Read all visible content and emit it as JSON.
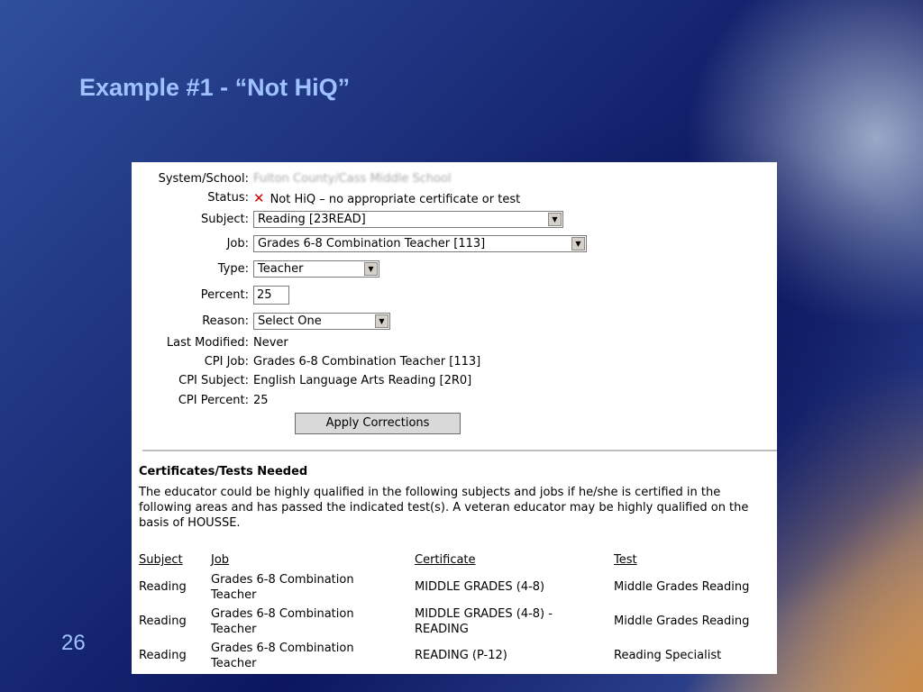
{
  "slide": {
    "title": "Example #1 - “Not HiQ”",
    "number": "26"
  },
  "form": {
    "labels": {
      "system_school": "System/School:",
      "status": "Status:",
      "subject": "Subject:",
      "job": "Job:",
      "type": "Type:",
      "percent": "Percent:",
      "reason": "Reason:",
      "last_modified": "Last Modified:",
      "cpi_job": "CPI Job:",
      "cpi_subject": "CPI Subject:",
      "cpi_percent": "CPI Percent:"
    },
    "system_school_value": "Fulton County/Cass Middle School",
    "status_text": "Not HiQ – no appropriate certificate or test",
    "status_icon": "x-icon",
    "subject_value": "Reading [23READ]",
    "job_value": "Grades 6-8 Combination Teacher [113]",
    "type_value": "Teacher",
    "percent_value": "25",
    "reason_value": "Select One",
    "last_modified_value": "Never",
    "cpi_job_value": "Grades 6-8 Combination Teacher [113]",
    "cpi_subject_value": "English Language Arts Reading [2R0]",
    "cpi_percent_value": "25",
    "apply_button": "Apply Corrections"
  },
  "certificates": {
    "title": "Certificates/Tests Needed",
    "description": "The educator could be highly qualified in the following subjects and jobs if he/she is certified in the following areas and has passed the indicated test(s). A veteran educator may be highly qualified on the basis of HOUSSE.",
    "headers": [
      "Subject",
      "Job",
      "Certificate",
      "Test"
    ],
    "rows": [
      {
        "subject": "Reading",
        "job": "Grades 6-8 Combination Teacher",
        "certificate": "MIDDLE GRADES (4-8)",
        "test": "Middle Grades Reading"
      },
      {
        "subject": "Reading",
        "job": "Grades 6-8 Combination Teacher",
        "certificate": "MIDDLE GRADES (4-8) - READING",
        "test": "Middle Grades Reading"
      },
      {
        "subject": "Reading",
        "job": "Grades 6-8 Combination Teacher",
        "certificate": "READING (P-12)",
        "test": "Reading Specialist"
      }
    ]
  }
}
